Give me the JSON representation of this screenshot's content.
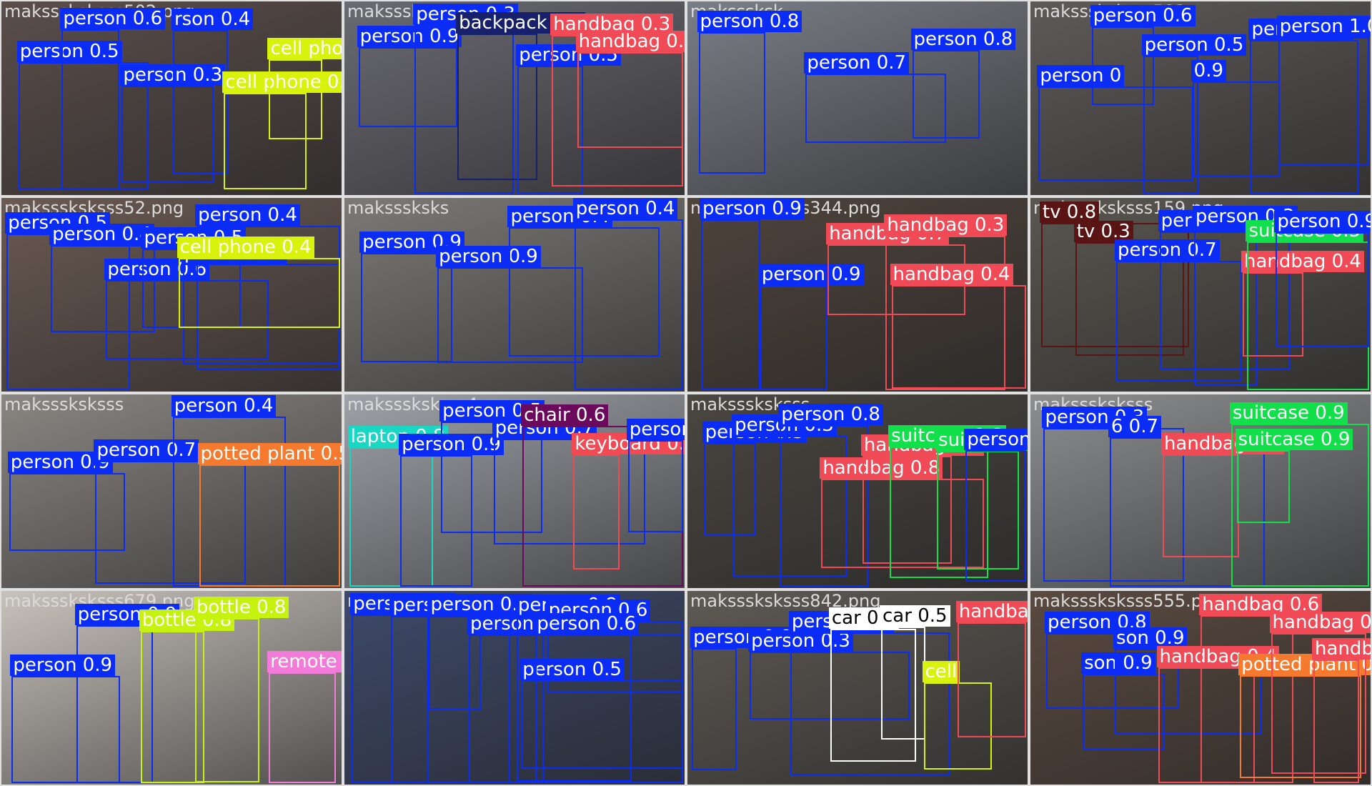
{
  "app": "object-detection-mosaic",
  "class_colors": {
    "person": "#0b2cf5",
    "handbag": "#ef4a55",
    "cell phone": "#d9f20b",
    "bottle": "#c6f20f",
    "backpack": "#16206b",
    "tv": "#5a1414",
    "suitcase": "#12e04a",
    "potted plant": "#f57a2e",
    "laptop": "#18d8c4",
    "chair": "#6b0a5c",
    "keyboard": "#f24a52",
    "remote": "#f27ad9",
    "car": "#ffffff"
  },
  "tiles": [
    {
      "filename": "maksssksksss502.png",
      "bg": "#5a4e4a",
      "detections": [
        {
          "label": "person 0.5",
          "class": "person"
        },
        {
          "label": "person 0.6",
          "class": "person"
        },
        {
          "label": "person 0.3",
          "class": "person"
        },
        {
          "label": "rson 0.4",
          "class": "person"
        },
        {
          "label": "cell phone 0.5",
          "class": "cell phone"
        },
        {
          "label": "cell phon",
          "class": "cell phone"
        }
      ]
    },
    {
      "filename": "maksssksksss",
      "bg": "#6a6a72",
      "detections": [
        {
          "label": "person 0.9",
          "class": "person"
        },
        {
          "label": "person 0.3",
          "class": "person"
        },
        {
          "label": "backpack 0.3",
          "class": "backpack"
        },
        {
          "label": "person 0.5",
          "class": "person"
        },
        {
          "label": "handbag 0.3",
          "class": "handbag"
        },
        {
          "label": "handbag 0.3",
          "class": "handbag"
        }
      ]
    },
    {
      "filename": "maksssksk",
      "bg": "#7a7e86",
      "detections": [
        {
          "label": "person 0.8",
          "class": "person"
        },
        {
          "label": "person 0.7",
          "class": "person"
        },
        {
          "label": "person 0.8",
          "class": "person"
        }
      ]
    },
    {
      "filename": "maksssksksss583",
      "bg": "#5e5a58",
      "detections": [
        {
          "label": "person 0",
          "class": "person"
        },
        {
          "label": "person 0.6",
          "class": "person"
        },
        {
          "label": "person 0.5",
          "class": "person"
        },
        {
          "label": "0.9",
          "class": "person"
        },
        {
          "label": "person 0.4",
          "class": "person"
        },
        {
          "label": "person 1.0",
          "class": "person"
        }
      ]
    },
    {
      "filename": "maksssksksss52.png",
      "bg": "#6a5a52",
      "detections": [
        {
          "label": "person 0.5",
          "class": "person"
        },
        {
          "label": "person 0.4",
          "class": "person"
        },
        {
          "label": "person 0.6",
          "class": "person"
        },
        {
          "label": "person 0.5",
          "class": "person"
        },
        {
          "label": "person 0.8",
          "class": "person"
        },
        {
          "label": "person 0.4",
          "class": "person"
        },
        {
          "label": "cell phone 0.4",
          "class": "cell phone"
        }
      ]
    },
    {
      "filename": "maksssksks",
      "bg": "#7c7a76",
      "detections": [
        {
          "label": "person 0.9",
          "class": "person"
        },
        {
          "label": "person 0.9",
          "class": "person"
        },
        {
          "label": "person 0.4",
          "class": "person"
        },
        {
          "label": "person 0.4",
          "class": "person"
        }
      ]
    },
    {
      "filename": "maksssksksss344.png",
      "bg": "#4e443c",
      "detections": [
        {
          "label": "person 0.9",
          "class": "person"
        },
        {
          "label": "person 0.9",
          "class": "person"
        },
        {
          "label": "handbag 0.7",
          "class": "handbag"
        },
        {
          "label": "handbag 0.3",
          "class": "handbag"
        },
        {
          "label": "handbag 0.4",
          "class": "handbag"
        }
      ]
    },
    {
      "filename": "maksssksksss159.png",
      "bg": "#5a5650",
      "detections": [
        {
          "label": "tv 0.8",
          "class": "tv"
        },
        {
          "label": "tv 0.3",
          "class": "tv"
        },
        {
          "label": "person 0.7",
          "class": "person"
        },
        {
          "label": "person 0.5",
          "class": "person"
        },
        {
          "label": "person 0.3",
          "class": "person"
        },
        {
          "label": "handbag 0.4",
          "class": "handbag"
        },
        {
          "label": "suitcase 0.5",
          "class": "suitcase"
        },
        {
          "label": "person 0.9",
          "class": "person"
        }
      ]
    },
    {
      "filename": "maksssksksss",
      "bg": "#8a8682",
      "detections": [
        {
          "label": "person 0.9",
          "class": "person"
        },
        {
          "label": "person 0.7",
          "class": "person"
        },
        {
          "label": "person 0.4",
          "class": "person"
        },
        {
          "label": "potted plant 0.5",
          "class": "potted plant"
        }
      ]
    },
    {
      "filename": "maksssksksss4",
      "bg": "#9ea2a8",
      "detections": [
        {
          "label": "laptop 0.8",
          "class": "laptop"
        },
        {
          "label": "person 0.9",
          "class": "person"
        },
        {
          "label": "person 0.5",
          "class": "person"
        },
        {
          "label": "person 0.7",
          "class": "person"
        },
        {
          "label": "chair 0.6",
          "class": "chair"
        },
        {
          "label": "keyboard 0.6",
          "class": "keyboard"
        },
        {
          "label": "person 0.9",
          "class": "person"
        }
      ]
    },
    {
      "filename": "maksssksksss",
      "bg": "#4a4640",
      "detections": [
        {
          "label": "person 0.3",
          "class": "person"
        },
        {
          "label": "person 0.3",
          "class": "person"
        },
        {
          "label": "person 0.8",
          "class": "person"
        },
        {
          "label": "handbag 0.8",
          "class": "handbag"
        },
        {
          "label": "handbag 0.7",
          "class": "handbag"
        },
        {
          "label": "suitcase 0.8",
          "class": "suitcase"
        },
        {
          "label": "suitcase 0.4",
          "class": "suitcase"
        },
        {
          "label": "person 0.3",
          "class": "person"
        }
      ]
    },
    {
      "filename": "maksssksksss",
      "bg": "#8c8e90",
      "detections": [
        {
          "label": "person 0.3",
          "class": "person"
        },
        {
          "label": "6 0.7",
          "class": "person"
        },
        {
          "label": "handbag 0.7",
          "class": "handbag"
        },
        {
          "label": "suitcase 0.9",
          "class": "suitcase"
        },
        {
          "label": "suitcase 0.9",
          "class": "suitcase"
        }
      ]
    },
    {
      "filename": "maksssksksss679.png",
      "bg": "#c8c2bc",
      "detections": [
        {
          "label": "person 0.9",
          "class": "person"
        },
        {
          "label": "person 0.9",
          "class": "person"
        },
        {
          "label": "bottle 0.8",
          "class": "bottle"
        },
        {
          "label": "bottle 0.8",
          "class": "bottle"
        },
        {
          "label": "remote 0.7",
          "class": "remote"
        }
      ]
    },
    {
      "filename": "maksssksksss705.png",
      "bg": "#3e4a6a",
      "detections": [
        {
          "label": "person 0.7",
          "class": "person"
        },
        {
          "label": "person 0.8",
          "class": "person"
        },
        {
          "label": "person 0.6",
          "class": "person"
        },
        {
          "label": "person 0.4",
          "class": "person"
        },
        {
          "label": "person 0.8",
          "class": "person"
        },
        {
          "label": "person 0.6",
          "class": "person"
        },
        {
          "label": "person 0.5",
          "class": "person"
        },
        {
          "label": "person 0.6",
          "class": "person"
        }
      ]
    },
    {
      "filename": "maksssksksss842.png",
      "bg": "#5e5a54",
      "detections": [
        {
          "label": "person 0.9",
          "class": "person"
        },
        {
          "label": "person 0.3",
          "class": "person"
        },
        {
          "label": "person 0.3",
          "class": "person"
        },
        {
          "label": "car 0.7",
          "class": "car"
        },
        {
          "label": "car 0.5",
          "class": "car"
        },
        {
          "label": "cell",
          "class": "cell phone"
        },
        {
          "label": "handbag 0.3",
          "class": "handbag"
        }
      ]
    },
    {
      "filename": "maksssksksss555.png",
      "bg": "#5a4a40",
      "detections": [
        {
          "label": "person 0.8",
          "class": "person"
        },
        {
          "label": "son 0.9",
          "class": "person"
        },
        {
          "label": "son 0.9",
          "class": "person"
        },
        {
          "label": "handbag 0.4",
          "class": "handbag"
        },
        {
          "label": "handbag 0.6",
          "class": "handbag"
        },
        {
          "label": "potted plant 0",
          "class": "potted plant"
        },
        {
          "label": "handbag 0.3",
          "class": "handbag"
        },
        {
          "label": "handbag 0.5",
          "class": "handbag"
        }
      ]
    }
  ]
}
